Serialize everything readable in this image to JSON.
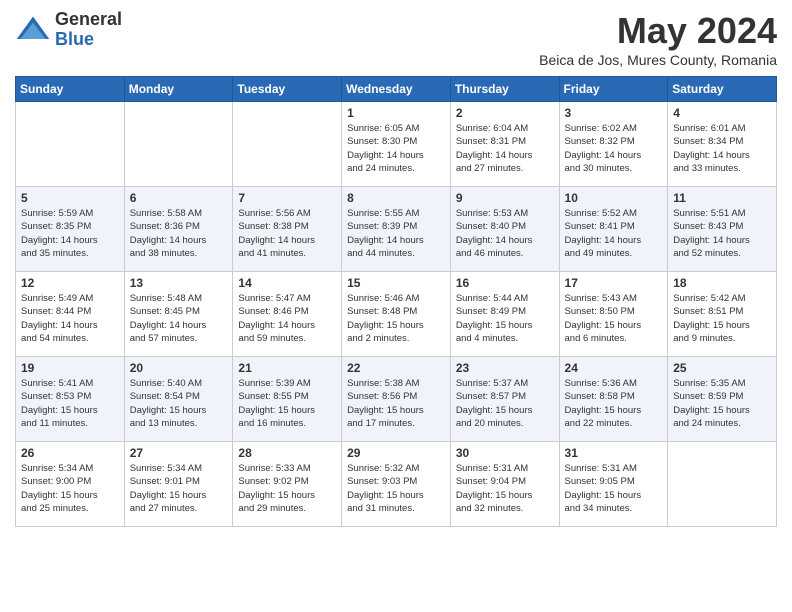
{
  "header": {
    "logo_general": "General",
    "logo_blue": "Blue",
    "month": "May 2024",
    "location": "Beica de Jos, Mures County, Romania"
  },
  "weekdays": [
    "Sunday",
    "Monday",
    "Tuesday",
    "Wednesday",
    "Thursday",
    "Friday",
    "Saturday"
  ],
  "weeks": [
    [
      {
        "day": "",
        "info": ""
      },
      {
        "day": "",
        "info": ""
      },
      {
        "day": "",
        "info": ""
      },
      {
        "day": "1",
        "info": "Sunrise: 6:05 AM\nSunset: 8:30 PM\nDaylight: 14 hours\nand 24 minutes."
      },
      {
        "day": "2",
        "info": "Sunrise: 6:04 AM\nSunset: 8:31 PM\nDaylight: 14 hours\nand 27 minutes."
      },
      {
        "day": "3",
        "info": "Sunrise: 6:02 AM\nSunset: 8:32 PM\nDaylight: 14 hours\nand 30 minutes."
      },
      {
        "day": "4",
        "info": "Sunrise: 6:01 AM\nSunset: 8:34 PM\nDaylight: 14 hours\nand 33 minutes."
      }
    ],
    [
      {
        "day": "5",
        "info": "Sunrise: 5:59 AM\nSunset: 8:35 PM\nDaylight: 14 hours\nand 35 minutes."
      },
      {
        "day": "6",
        "info": "Sunrise: 5:58 AM\nSunset: 8:36 PM\nDaylight: 14 hours\nand 38 minutes."
      },
      {
        "day": "7",
        "info": "Sunrise: 5:56 AM\nSunset: 8:38 PM\nDaylight: 14 hours\nand 41 minutes."
      },
      {
        "day": "8",
        "info": "Sunrise: 5:55 AM\nSunset: 8:39 PM\nDaylight: 14 hours\nand 44 minutes."
      },
      {
        "day": "9",
        "info": "Sunrise: 5:53 AM\nSunset: 8:40 PM\nDaylight: 14 hours\nand 46 minutes."
      },
      {
        "day": "10",
        "info": "Sunrise: 5:52 AM\nSunset: 8:41 PM\nDaylight: 14 hours\nand 49 minutes."
      },
      {
        "day": "11",
        "info": "Sunrise: 5:51 AM\nSunset: 8:43 PM\nDaylight: 14 hours\nand 52 minutes."
      }
    ],
    [
      {
        "day": "12",
        "info": "Sunrise: 5:49 AM\nSunset: 8:44 PM\nDaylight: 14 hours\nand 54 minutes."
      },
      {
        "day": "13",
        "info": "Sunrise: 5:48 AM\nSunset: 8:45 PM\nDaylight: 14 hours\nand 57 minutes."
      },
      {
        "day": "14",
        "info": "Sunrise: 5:47 AM\nSunset: 8:46 PM\nDaylight: 14 hours\nand 59 minutes."
      },
      {
        "day": "15",
        "info": "Sunrise: 5:46 AM\nSunset: 8:48 PM\nDaylight: 15 hours\nand 2 minutes."
      },
      {
        "day": "16",
        "info": "Sunrise: 5:44 AM\nSunset: 8:49 PM\nDaylight: 15 hours\nand 4 minutes."
      },
      {
        "day": "17",
        "info": "Sunrise: 5:43 AM\nSunset: 8:50 PM\nDaylight: 15 hours\nand 6 minutes."
      },
      {
        "day": "18",
        "info": "Sunrise: 5:42 AM\nSunset: 8:51 PM\nDaylight: 15 hours\nand 9 minutes."
      }
    ],
    [
      {
        "day": "19",
        "info": "Sunrise: 5:41 AM\nSunset: 8:53 PM\nDaylight: 15 hours\nand 11 minutes."
      },
      {
        "day": "20",
        "info": "Sunrise: 5:40 AM\nSunset: 8:54 PM\nDaylight: 15 hours\nand 13 minutes."
      },
      {
        "day": "21",
        "info": "Sunrise: 5:39 AM\nSunset: 8:55 PM\nDaylight: 15 hours\nand 16 minutes."
      },
      {
        "day": "22",
        "info": "Sunrise: 5:38 AM\nSunset: 8:56 PM\nDaylight: 15 hours\nand 17 minutes."
      },
      {
        "day": "23",
        "info": "Sunrise: 5:37 AM\nSunset: 8:57 PM\nDaylight: 15 hours\nand 20 minutes."
      },
      {
        "day": "24",
        "info": "Sunrise: 5:36 AM\nSunset: 8:58 PM\nDaylight: 15 hours\nand 22 minutes."
      },
      {
        "day": "25",
        "info": "Sunrise: 5:35 AM\nSunset: 8:59 PM\nDaylight: 15 hours\nand 24 minutes."
      }
    ],
    [
      {
        "day": "26",
        "info": "Sunrise: 5:34 AM\nSunset: 9:00 PM\nDaylight: 15 hours\nand 25 minutes."
      },
      {
        "day": "27",
        "info": "Sunrise: 5:34 AM\nSunset: 9:01 PM\nDaylight: 15 hours\nand 27 minutes."
      },
      {
        "day": "28",
        "info": "Sunrise: 5:33 AM\nSunset: 9:02 PM\nDaylight: 15 hours\nand 29 minutes."
      },
      {
        "day": "29",
        "info": "Sunrise: 5:32 AM\nSunset: 9:03 PM\nDaylight: 15 hours\nand 31 minutes."
      },
      {
        "day": "30",
        "info": "Sunrise: 5:31 AM\nSunset: 9:04 PM\nDaylight: 15 hours\nand 32 minutes."
      },
      {
        "day": "31",
        "info": "Sunrise: 5:31 AM\nSunset: 9:05 PM\nDaylight: 15 hours\nand 34 minutes."
      },
      {
        "day": "",
        "info": ""
      }
    ]
  ]
}
